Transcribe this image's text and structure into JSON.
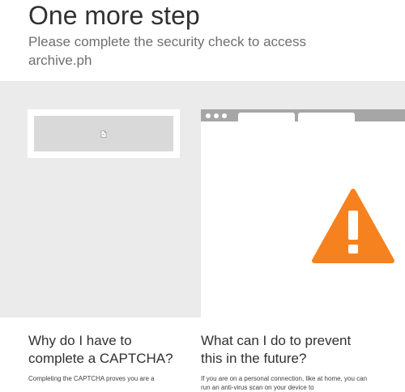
{
  "header": {
    "title": "One more step",
    "subtitle": "Please complete the security check to access archive.ph"
  },
  "captcha": {
    "icon": "broken-image-icon"
  },
  "illustration": {
    "icon": "warning-triangle-icon",
    "accent_color": "#f6821f"
  },
  "faq": [
    {
      "heading": "Why do I have to complete a CAPTCHA?",
      "body": "Completing the CAPTCHA proves you are a"
    },
    {
      "heading": "What can I do to prevent this in the future?",
      "body": "If you are on a personal connection, like at home, you can run an anti-virus scan on your device to"
    }
  ]
}
